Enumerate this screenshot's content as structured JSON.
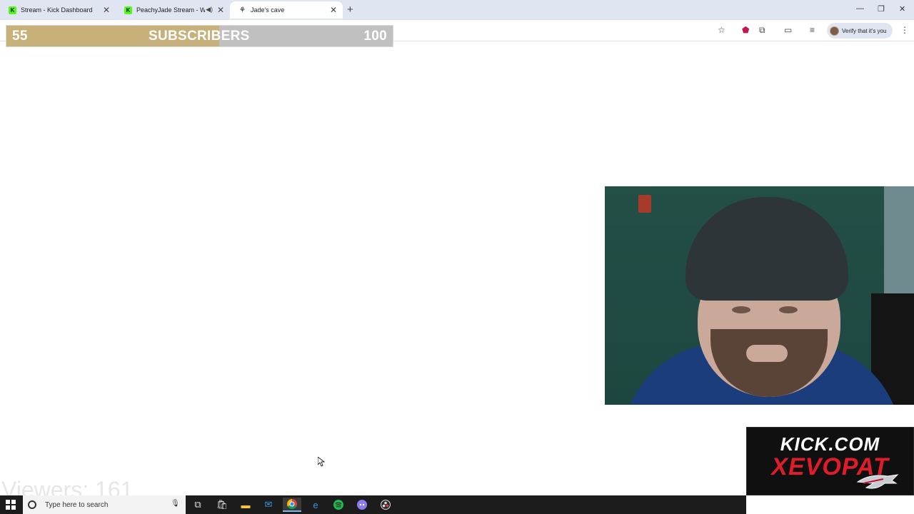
{
  "browser": {
    "tabs": [
      {
        "title": "Stream - Kick Dashboard",
        "favicon": "kick-icon"
      },
      {
        "title": "PeachyJade Stream - Watch",
        "favicon": "kick-icon"
      },
      {
        "title": "Jade's cave",
        "favicon": "jade-icon"
      }
    ],
    "verify_label": "Verify that it's you"
  },
  "subscriber_goal": {
    "current": "55",
    "label": "SUBSCRIBERS",
    "target": "100",
    "progress_fraction": 0.55,
    "fill_color": "#c8b07a"
  },
  "overlay": {
    "kick_line1": "KICK.COM",
    "kick_line2": "XEVOPAT",
    "viewers": "Viewers: 161",
    "accent_red": "#e01c2a"
  },
  "taskbar": {
    "search_placeholder": "Type here to search",
    "apps": [
      "task-view-icon",
      "store-icon",
      "file-explorer-icon",
      "mail-icon",
      "chrome-icon",
      "edge-icon",
      "spotify-icon",
      "discord-icon",
      "obs-icon"
    ]
  }
}
